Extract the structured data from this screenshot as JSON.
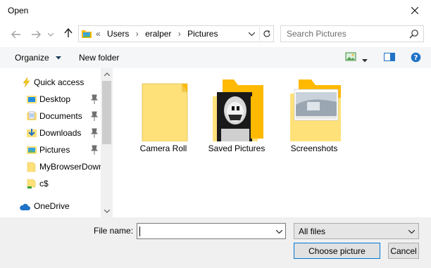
{
  "window": {
    "title": "Open"
  },
  "address": {
    "prefix": "«",
    "crumbs": [
      "Users",
      "eralper",
      "Pictures"
    ]
  },
  "search": {
    "placeholder": "Search Pictures"
  },
  "toolbar": {
    "organize_label": "Organize",
    "new_folder_label": "New folder"
  },
  "sidebar": {
    "items": [
      {
        "label": "Quick access",
        "icon": "star-lightning-icon",
        "pinned": false
      },
      {
        "label": "Desktop",
        "icon": "desktop-folder-icon",
        "pinned": true
      },
      {
        "label": "Documents",
        "icon": "documents-folder-icon",
        "pinned": true
      },
      {
        "label": "Downloads",
        "icon": "downloads-folder-icon",
        "pinned": true
      },
      {
        "label": "Pictures",
        "icon": "pictures-folder-icon",
        "pinned": true
      },
      {
        "label": "MyBrowserDown",
        "icon": "folder-icon",
        "pinned": false
      },
      {
        "label": "c$",
        "icon": "network-share-icon",
        "pinned": false
      },
      {
        "label": "OneDrive",
        "icon": "cloud-icon",
        "pinned": false
      }
    ]
  },
  "content": {
    "folders": [
      {
        "label": "Camera Roll",
        "icon": "empty-folder-icon"
      },
      {
        "label": "Saved Pictures",
        "icon": "photo-folder-icon"
      },
      {
        "label": "Screenshots",
        "icon": "screenshot-folder-icon"
      }
    ]
  },
  "footer": {
    "file_name_label": "File name:",
    "file_name_value": "",
    "filter_value": "All files",
    "open_button_label": "Choose picture",
    "cancel_button_label": "Cancel"
  },
  "colors": {
    "folder_yellow": "#ffe17a",
    "folder_dark": "#ffb900",
    "accent_blue": "#0078d7",
    "link_text": "#1e395b"
  }
}
